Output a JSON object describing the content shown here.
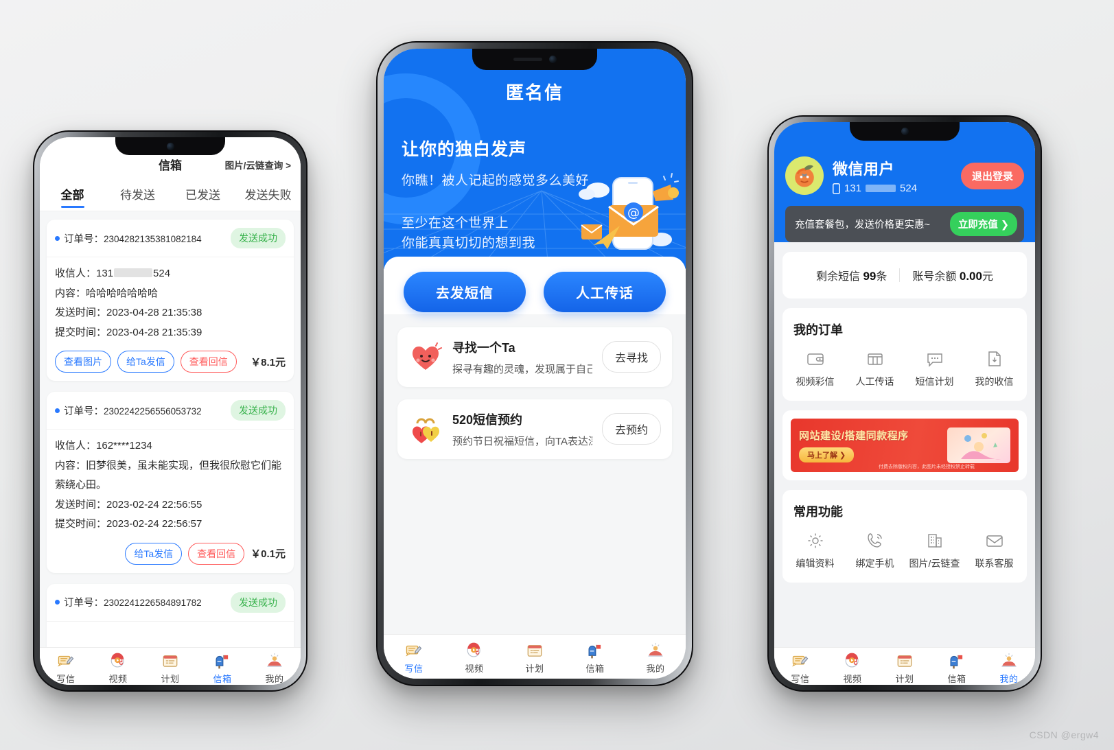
{
  "watermark": "CSDN @ergw4",
  "left_phone": {
    "title": "信箱",
    "top_right_link": "图片/云链查询 >",
    "tabs": [
      {
        "label": "全部",
        "active": true
      },
      {
        "label": "待发送",
        "active": false
      },
      {
        "label": "已发送",
        "active": false
      },
      {
        "label": "发送失败",
        "active": false
      }
    ],
    "labels": {
      "order_no": "订单号：",
      "recipient": "收信人：",
      "content": "内容：",
      "send_time": "发送时间：",
      "submit_time": "提交时间："
    },
    "orders": [
      {
        "order_no": "2304282135381082184",
        "status": "发送成功",
        "recipient_prefix": "131",
        "recipient_suffix": "524",
        "recipient_masked": true,
        "content": "哈哈哈哈哈哈哈",
        "send_time": "2023-04-28 21:35:38",
        "submit_time": "2023-04-28 21:35:39",
        "actions": [
          "查看图片",
          "给Ta发信",
          "查看回信"
        ],
        "price": "￥8.1元"
      },
      {
        "order_no": "2302242256556053732",
        "status": "发送成功",
        "recipient": "162****1234",
        "recipient_masked": false,
        "content": "旧梦很美，虽未能实现，但我很欣慰它们能萦绕心田。",
        "send_time": "2023-02-24 22:56:55",
        "submit_time": "2023-02-24 22:56:57",
        "actions": [
          "给Ta发信",
          "查看回信"
        ],
        "price": "￥0.1元"
      },
      {
        "order_no": "2302241226584891782",
        "status": "发送成功",
        "partial": true
      }
    ],
    "tabbar": [
      {
        "label": "写信",
        "icon": "write-letter-icon",
        "active": false
      },
      {
        "label": "视频",
        "icon": "video-icon",
        "active": false
      },
      {
        "label": "计划",
        "icon": "plan-icon",
        "active": false
      },
      {
        "label": "信箱",
        "icon": "mailbox-icon",
        "active": true
      },
      {
        "label": "我的",
        "icon": "profile-icon",
        "active": false
      }
    ]
  },
  "mid_phone": {
    "app_title": "匿名信",
    "hero": {
      "headline": "让你的独白发声",
      "subline": "你瞧！被人记起的感觉多么美好",
      "tagline_1": "至少在这个世界上",
      "tagline_2": "你能真真切切的想到我"
    },
    "primary_buttons": [
      {
        "label": "去发短信"
      },
      {
        "label": "人工传话"
      }
    ],
    "features": [
      {
        "icon": "heart-face-icon",
        "title": "寻找一个Ta",
        "subtitle": "探寻有趣的灵魂，发现属于自己",
        "button": "去寻找"
      },
      {
        "icon": "double-lock-hearts-icon",
        "title": "520短信预约",
        "subtitle": "预约节日祝福短信，向TA表达深",
        "button": "去预约"
      }
    ],
    "tabbar": [
      {
        "label": "写信",
        "icon": "write-letter-icon",
        "active": true
      },
      {
        "label": "视频",
        "icon": "video-icon",
        "active": false
      },
      {
        "label": "计划",
        "icon": "plan-icon",
        "active": false
      },
      {
        "label": "信箱",
        "icon": "mailbox-icon",
        "active": false
      },
      {
        "label": "我的",
        "icon": "profile-icon",
        "active": false
      }
    ]
  },
  "right_phone": {
    "username": "微信用户",
    "phone_prefix": "131",
    "phone_suffix": "524",
    "logout_label": "退出登录",
    "recharge_text": "充值套餐包，发送价格更实惠~",
    "recharge_button": "立即充值 ❯",
    "balance": {
      "sms_label": "剩余短信",
      "sms_value": "99",
      "sms_unit": "条",
      "money_label": "账号余额",
      "money_value": "0.00",
      "money_unit": "元"
    },
    "orders_section": {
      "title": "我的订单",
      "items": [
        {
          "label": "视频彩信",
          "icon": "wallet-icon"
        },
        {
          "label": "人工传话",
          "icon": "card-icon"
        },
        {
          "label": "短信计划",
          "icon": "chat-bubble-icon"
        },
        {
          "label": "我的收信",
          "icon": "receive-mail-icon"
        }
      ]
    },
    "ad": {
      "headline": "网站建设/搭建同款程序",
      "button": "马上了解 ❯",
      "fine_print": "付费去除版权内容，此图片未经授权禁止转载"
    },
    "tools_section": {
      "title": "常用功能",
      "items": [
        {
          "label": "编辑资料",
          "icon": "gear-icon"
        },
        {
          "label": "绑定手机",
          "icon": "phone-call-icon"
        },
        {
          "label": "图片/云链查",
          "icon": "building-icon"
        },
        {
          "label": "联系客服",
          "icon": "envelope-icon"
        }
      ]
    },
    "tabbar": [
      {
        "label": "写信",
        "icon": "write-letter-icon",
        "active": false
      },
      {
        "label": "视频",
        "icon": "video-icon",
        "active": false
      },
      {
        "label": "计划",
        "icon": "plan-icon",
        "active": false
      },
      {
        "label": "信箱",
        "icon": "mailbox-icon",
        "active": false
      },
      {
        "label": "我的",
        "icon": "profile-icon",
        "active": true
      }
    ]
  },
  "colors": {
    "brand_blue": "#1272f0",
    "accent_blue": "#2979ff",
    "success_green": "#36b14a",
    "danger_red": "#ff5a5a",
    "logout_red": "#fa6a62",
    "recharge_green": "#35d05c",
    "ad_red": "#e8372c"
  }
}
